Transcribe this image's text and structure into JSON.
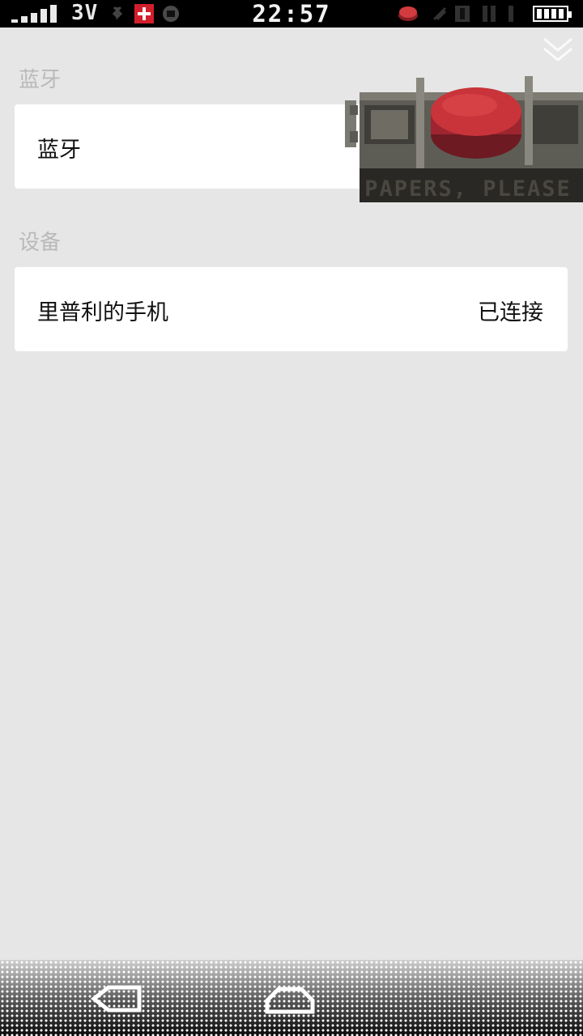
{
  "status_bar": {
    "network": "3V",
    "time": "22:57",
    "icons": [
      "signal-icon",
      "data-icon",
      "swiss-flag-icon",
      "sync-icon",
      "game-icon",
      "vibrate-icon",
      "notification-icon",
      "battery-icon"
    ]
  },
  "sections": [
    {
      "title": "蓝牙",
      "rows": [
        {
          "label": "蓝牙",
          "value": ""
        }
      ]
    },
    {
      "title": "设备",
      "rows": [
        {
          "label": "里普利的手机",
          "value": "已连接"
        }
      ]
    }
  ],
  "overlay": {
    "caption": "PAPERS, PLEASE",
    "button_color": "#c8343a"
  },
  "colors": {
    "background": "#e6e6e6",
    "card": "#ffffff",
    "section_title": "#b9b9b9"
  },
  "nav": {
    "icons": [
      "back-icon",
      "home-icon"
    ]
  }
}
